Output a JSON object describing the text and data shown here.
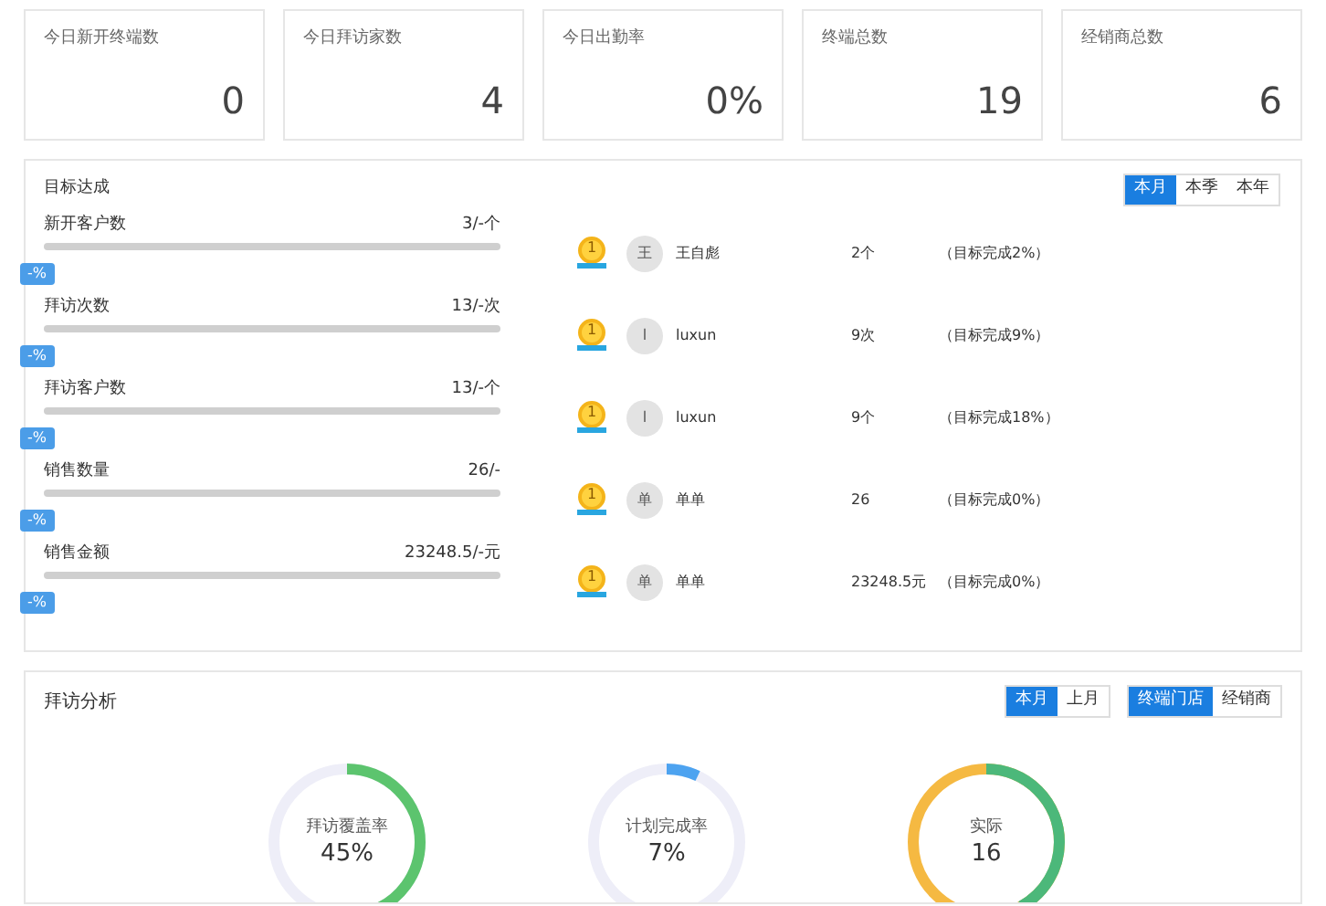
{
  "stats": [
    {
      "label": "今日新开终端数",
      "value": "0"
    },
    {
      "label": "今日拜访家数",
      "value": "4"
    },
    {
      "label": "今日出勤率",
      "value": "0%"
    },
    {
      "label": "终端总数",
      "value": "19"
    },
    {
      "label": "经销商总数",
      "value": "6"
    }
  ],
  "targets": {
    "title": "目标达成",
    "tabs": [
      {
        "label": "本月",
        "selected": true
      },
      {
        "label": "本季",
        "selected": false
      },
      {
        "label": "本年",
        "selected": false
      }
    ],
    "metrics": [
      {
        "name": "新开客户数",
        "reading": "3/-个",
        "level": 0,
        "percent": "-%"
      },
      {
        "name": "拜访次数",
        "reading": "13/-次",
        "level": 0,
        "percent": "-%"
      },
      {
        "name": "拜访客户数",
        "reading": "13/-个",
        "level": 0,
        "percent": "-%"
      },
      {
        "name": "销售数量",
        "reading": "26/-",
        "level": 0,
        "percent": "-%"
      },
      {
        "name": "销售金额",
        "reading": "23248.5/-元",
        "level": 0,
        "percent": "-%"
      }
    ],
    "leaders": [
      {
        "rank": "1",
        "avatar": "王",
        "name": "王自彪",
        "value": "2个",
        "goal": "（目标完成2%）"
      },
      {
        "rank": "1",
        "avatar": "l",
        "name": "luxun",
        "value": "9次",
        "goal": "（目标完成9%）"
      },
      {
        "rank": "1",
        "avatar": "l",
        "name": "luxun",
        "value": "9个",
        "goal": "（目标完成18%）"
      },
      {
        "rank": "1",
        "avatar": "单",
        "name": "单单",
        "value": "26",
        "goal": "（目标完成0%）"
      },
      {
        "rank": "1",
        "avatar": "单",
        "name": "单单",
        "value": "23248.5元",
        "goal": "（目标完成0%）"
      }
    ]
  },
  "visits": {
    "title": "拜访分析",
    "period_tabs": [
      {
        "label": "本月",
        "selected": true
      },
      {
        "label": "上月",
        "selected": false
      }
    ],
    "type_tabs": [
      {
        "label": "终端门店",
        "selected": true
      },
      {
        "label": "经销商",
        "selected": false
      }
    ],
    "gauges": [
      {
        "label": "拜访覆盖率",
        "value": "45%"
      },
      {
        "label": "计划完成率",
        "value": "7%"
      },
      {
        "label": "实际",
        "value": "16"
      }
    ]
  }
}
